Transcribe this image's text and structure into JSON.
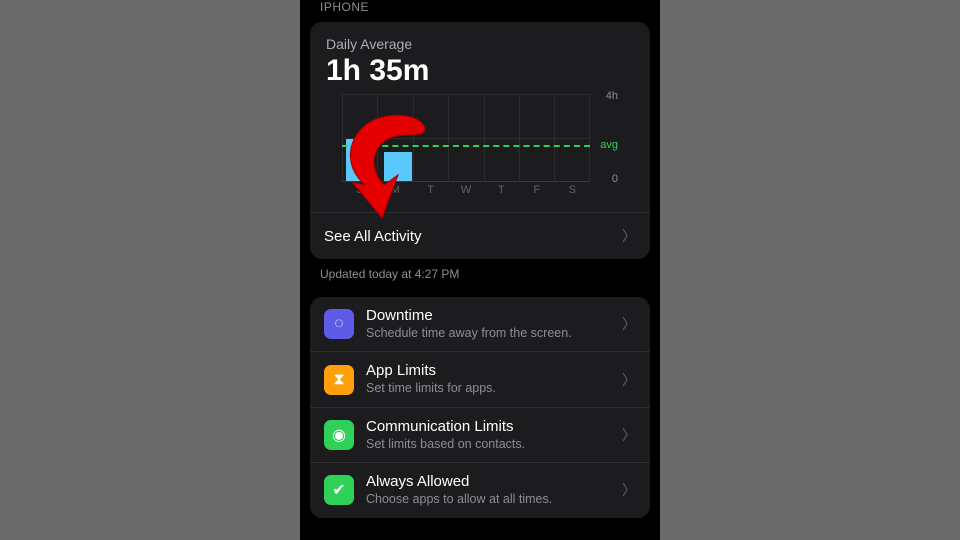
{
  "header": {
    "section": "IPHONE"
  },
  "summary": {
    "label": "Daily Average",
    "value": "1h 35m",
    "see_all": "See All Activity",
    "updated": "Updated today at 4:27 PM"
  },
  "chart_data": {
    "type": "bar",
    "categories": [
      "S",
      "M",
      "T",
      "W",
      "T",
      "F",
      "S"
    ],
    "values": [
      1.9,
      1.3,
      0,
      0,
      0,
      0,
      0
    ],
    "unit": "hours",
    "ylim": [
      0,
      4
    ],
    "yticks": {
      "max": "4h",
      "min": "0"
    },
    "avg_label": "avg",
    "avg_value": 1.6,
    "title": "",
    "xlabel": "",
    "ylabel": ""
  },
  "options": [
    {
      "icon": "downtime-icon",
      "bg": "#5e5ce6",
      "glyph": "◌",
      "label": "Downtime",
      "sub": "Schedule time away from the screen."
    },
    {
      "icon": "hourglass-icon",
      "bg": "#ff9f0a",
      "glyph": "⧗",
      "label": "App Limits",
      "sub": "Set time limits for apps."
    },
    {
      "icon": "person-icon",
      "bg": "#30d158",
      "glyph": "◉",
      "label": "Communication Limits",
      "sub": "Set limits based on contacts."
    },
    {
      "icon": "check-shield-icon",
      "bg": "#30d158",
      "glyph": "✔",
      "label": "Always Allowed",
      "sub": "Choose apps to allow at all times."
    }
  ],
  "annotation": {
    "type": "callout-arrow",
    "color": "#e40000",
    "points_to": "see-all-activity-row"
  }
}
